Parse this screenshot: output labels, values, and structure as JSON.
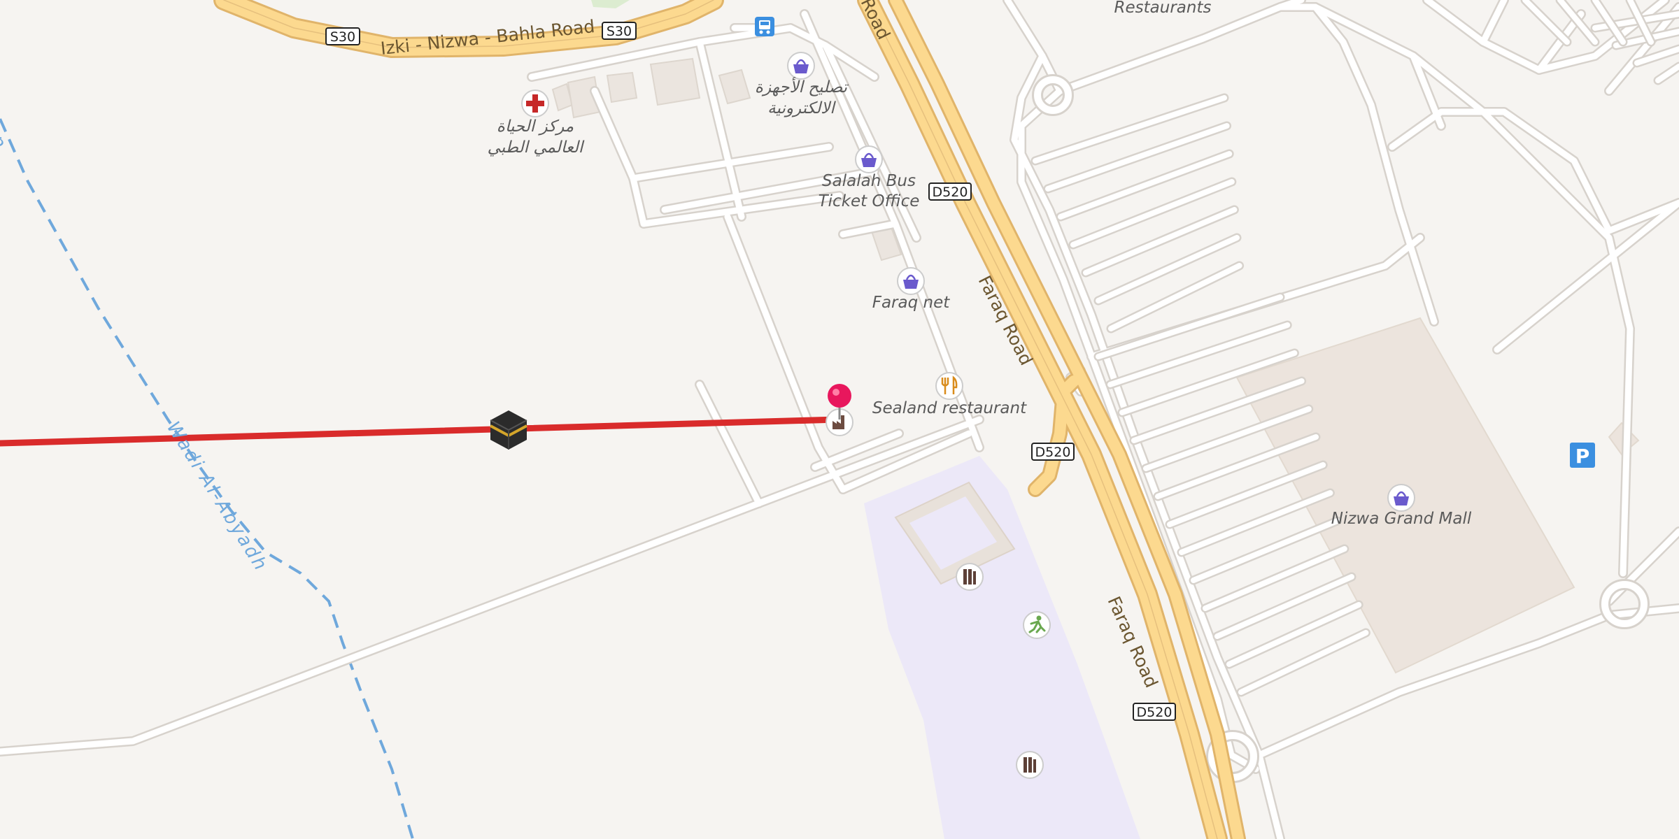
{
  "map": {
    "colors": {
      "background": "#f6f4f1",
      "major_road": "#fcd98f",
      "major_road_casing": "#e0b46a",
      "minor_road": "#ffffff",
      "minor_road_casing": "#d7d2cc",
      "building": "#ebe5df",
      "mall_area": "#ece4dd",
      "school_area": "#ece8f8",
      "wadi": "#6fa8dc",
      "route_line": "#d92b2b",
      "pin": "#e8175d",
      "poi_shop": "#6a5acd",
      "poi_food": "#d98c1c",
      "parking": "#3b8fe0"
    },
    "roads": {
      "izki_nizwa_bahla": "Izki - Nizwa - Bahla Road",
      "faraq_road_1": "Faraq Road",
      "faraq_road_2": "Faraq Road",
      "faraq_road_top": "Road"
    },
    "shields": {
      "s30_a": "S30",
      "s30_b": "S30",
      "d520_a": "D520",
      "d520_b": "D520",
      "d520_c": "D520"
    },
    "pois": {
      "medical_line1": "مركز الحياة",
      "medical_line2": "العالمي الطبي",
      "electronics_line1": "تصليح الأجهزة",
      "electronics_line2": "الالكترونية",
      "bus_ticket_line1": "Salalah Bus",
      "bus_ticket_line2": "Ticket Office",
      "faraq_net": "Faraq net",
      "sealand": "Sealand restaurant",
      "nizwa_mall": "Nizwa Grand Mall",
      "restaurants": "Restaurants",
      "parking": "P"
    },
    "wadi_label": "Wadi Al-Abyadh",
    "wadi_label_top": "dh",
    "icons": {
      "medical": "red-cross-icon",
      "shop": "shopping-basket-icon",
      "bus": "bus-stop-icon",
      "food": "fork-knife-icon",
      "factory": "factory-icon",
      "library": "library-icon",
      "sport": "running-person-icon",
      "kaaba": "kaaba-icon",
      "pin": "location-pin-icon",
      "parking": "parking-icon"
    }
  }
}
